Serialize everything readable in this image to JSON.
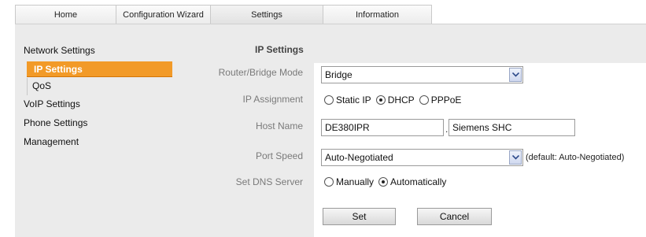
{
  "tabs": [
    {
      "label": "Home",
      "active": false
    },
    {
      "label": "Configuration Wizard",
      "active": false
    },
    {
      "label": "Settings",
      "active": true
    },
    {
      "label": "Information",
      "active": false
    }
  ],
  "sidebar": {
    "network_settings": "Network Settings",
    "ip_settings": "IP Settings",
    "qos": "QoS",
    "voip_settings": "VoIP Settings",
    "phone_settings": "Phone Settings",
    "management": "Management"
  },
  "form": {
    "title": "IP Settings",
    "router_bridge_mode": {
      "label": "Router/Bridge Mode",
      "value": "Bridge"
    },
    "ip_assignment": {
      "label": "IP Assignment",
      "options": [
        "Static IP",
        "DHCP",
        "PPPoE"
      ],
      "selected": "DHCP"
    },
    "host_name": {
      "label": "Host Name",
      "value1": "DE380IPR",
      "separator": ".",
      "value2": "Siemens SHC"
    },
    "port_speed": {
      "label": "Port Speed",
      "value": "Auto-Negotiated",
      "hint": "(default: Auto-Negotiated)"
    },
    "dns_server": {
      "label": "Set DNS Server",
      "options": [
        "Manually",
        "Automatically"
      ],
      "selected": "Automatically"
    },
    "buttons": {
      "set": "Set",
      "cancel": "Cancel"
    }
  },
  "colors": {
    "accent": "#f29a28",
    "panel": "#ebebeb"
  }
}
